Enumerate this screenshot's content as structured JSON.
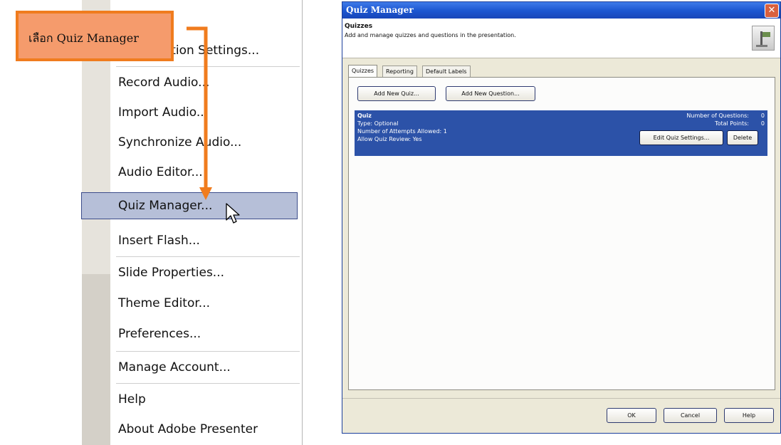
{
  "callout": {
    "text": "เลือก Quiz Manager"
  },
  "menu": {
    "items": [
      {
        "label": "Presentation Settings..."
      },
      {
        "label": "Record Audio..."
      },
      {
        "label": "Import Audio..."
      },
      {
        "label": "Synchronize Audio..."
      },
      {
        "label": "Audio Editor..."
      },
      {
        "label": "Quiz Manager...",
        "highlighted": true
      },
      {
        "label": "Insert Flash..."
      },
      {
        "label": "Slide Properties..."
      },
      {
        "label": "Theme Editor..."
      },
      {
        "label": "Preferences..."
      },
      {
        "label": "Manage Account..."
      },
      {
        "label": "Help"
      },
      {
        "label": "About Adobe Presenter"
      }
    ]
  },
  "dialog": {
    "title": "Quiz Manager",
    "close_glyph": "✕",
    "banner_title": "Quizzes",
    "banner_desc": "Add and manage quizzes and questions in the presentation.",
    "tabs": [
      {
        "label": "Quizzes",
        "active": true
      },
      {
        "label": "Reporting"
      },
      {
        "label": "Default Labels"
      }
    ],
    "add_quiz_label": "Add New Quiz...",
    "add_question_label": "Add New Question...",
    "quiz": {
      "name": "Quiz",
      "type": "Type: Optional",
      "attempts": "Number of Attempts Allowed: 1",
      "review": "Allow Quiz Review: Yes",
      "num_questions_label": "Number of Questions:",
      "num_questions_value": "0",
      "total_points_label": "Total Points:",
      "total_points_value": "0",
      "edit_label": "Edit Quiz Settings...",
      "delete_label": "Delete"
    },
    "ok_label": "OK",
    "cancel_label": "Cancel",
    "help_label": "Help"
  },
  "colors": {
    "accent_orange": "#f07c1e",
    "selection_blue": "#2c52a8",
    "menu_highlight": "#b6bfd8"
  }
}
